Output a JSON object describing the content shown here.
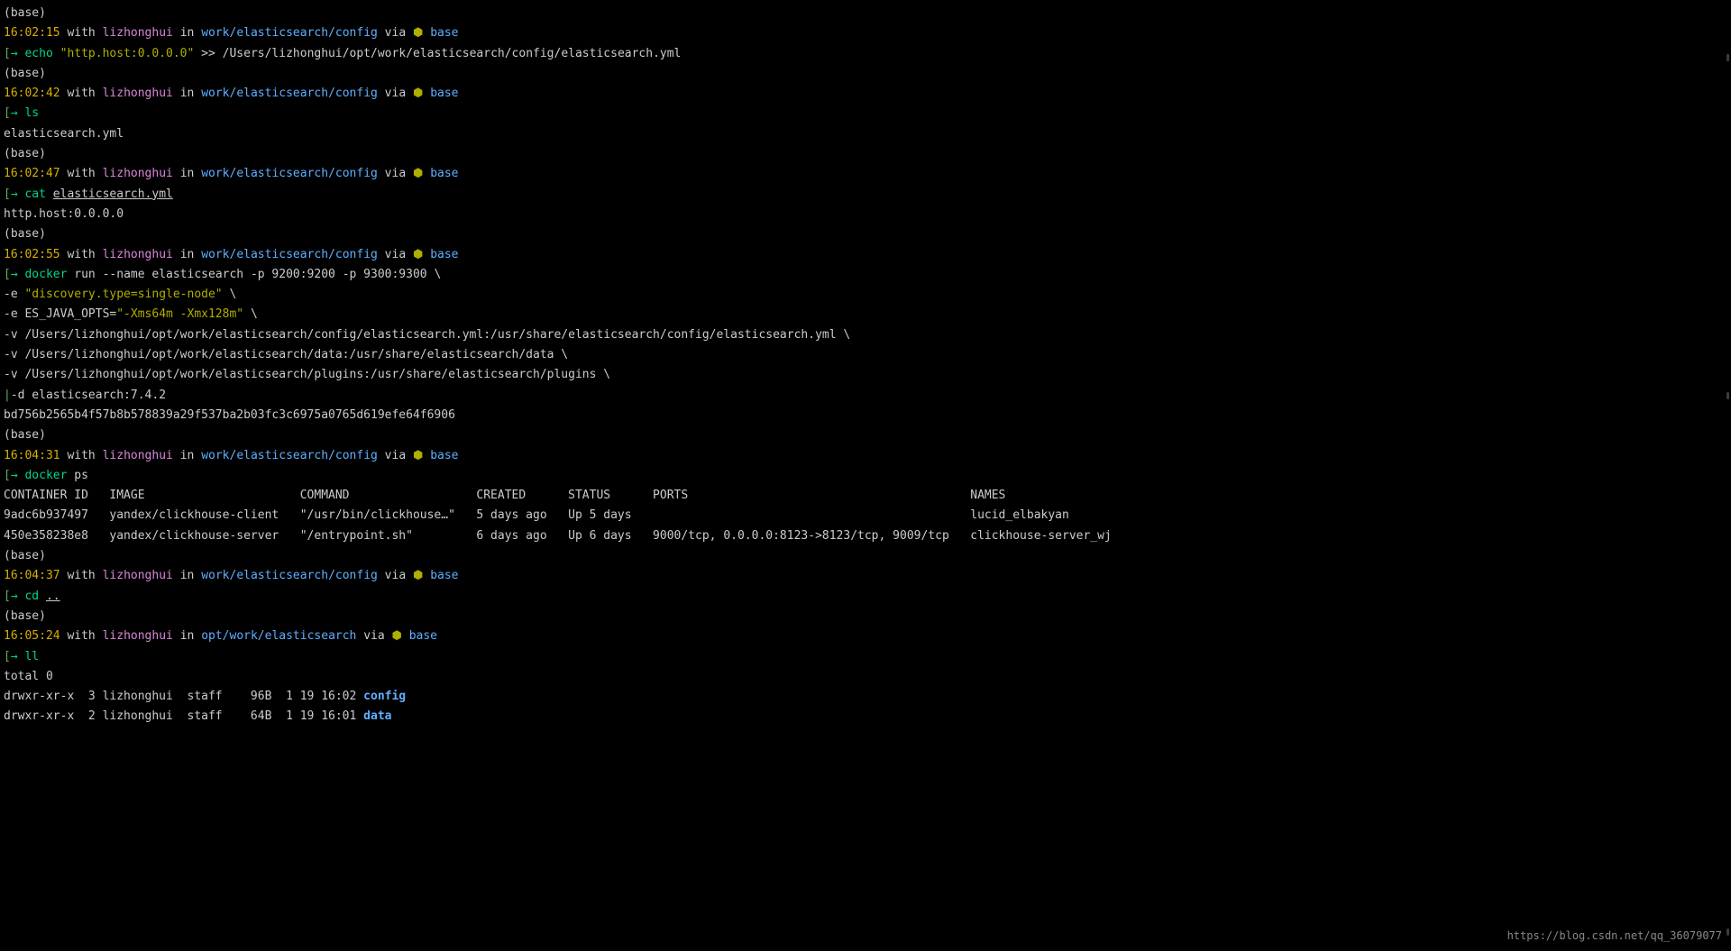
{
  "watermark": "https://blog.csdn.net/qq_36079077",
  "baseLabel": "(base)",
  "prompts": [
    {
      "time": "16:02:15",
      "user": "lizhonghui",
      "path": "work/elasticsearch/config",
      "env": "base"
    },
    {
      "time": "16:02:42",
      "user": "lizhonghui",
      "path": "work/elasticsearch/config",
      "env": "base"
    },
    {
      "time": "16:02:47",
      "user": "lizhonghui",
      "path": "work/elasticsearch/config",
      "env": "base"
    },
    {
      "time": "16:02:55",
      "user": "lizhonghui",
      "path": "work/elasticsearch/config",
      "env": "base"
    },
    {
      "time": "16:04:31",
      "user": "lizhonghui",
      "path": "work/elasticsearch/config",
      "env": "base"
    },
    {
      "time": "16:04:37",
      "user": "lizhonghui",
      "path": "work/elasticsearch/config",
      "env": "base"
    },
    {
      "time": "16:05:24",
      "user": "lizhonghui",
      "path": "opt/work/elasticsearch",
      "env": "base"
    }
  ],
  "cmds": {
    "echo": "echo",
    "echoArg": "\"http.host:0.0.0.0\"",
    "echoRedir": " >> /Users/lizhonghui/opt/work/elasticsearch/config/elasticsearch.yml",
    "ls": "ls",
    "lsOut": "elasticsearch.yml",
    "cat": "cat",
    "catFile": "elasticsearch.yml",
    "catOut": "http.host:0.0.0.0",
    "docker": "docker",
    "dockerRunArgs": " run --name elasticsearch -p 9200:9200 -p 9300:9300 \\",
    "dockerLine2a": "-e ",
    "dockerLine2b": "\"discovery.type=single-node\"",
    "dockerLine2c": " \\",
    "dockerLine3a": "-e ES_JAVA_OPTS=",
    "dockerLine3b": "\"-Xms64m -Xmx128m\"",
    "dockerLine3c": " \\",
    "dockerLine4": "-v /Users/lizhonghui/opt/work/elasticsearch/config/elasticsearch.yml:/usr/share/elasticsearch/config/elasticsearch.yml \\",
    "dockerLine5": "-v /Users/lizhonghui/opt/work/elasticsearch/data:/usr/share/elasticsearch/data \\",
    "dockerLine6": "-v /Users/lizhonghui/opt/work/elasticsearch/plugins:/usr/share/elasticsearch/plugins \\",
    "dockerLine7": "-d elasticsearch:7.4.2",
    "dockerHash": "bd756b2565b4f57b8b578839a29f537ba2b03fc3c6975a0765d619efe64f6906",
    "dockerPs": " ps",
    "cd": "cd",
    "cdArg": "..",
    "ll": "ll",
    "llTotal": "total 0",
    "llRow1a": "drwxr-xr-x  3 lizhonghui  staff    96B  1 19 16:02 ",
    "llRow1b": "config",
    "llRow2a": "drwxr-xr-x  2 lizhonghui  staff    64B  1 19 16:01 ",
    "llRow2b": "data"
  },
  "psHeader": "CONTAINER ID   IMAGE                      COMMAND                  CREATED      STATUS      PORTS                                        NAMES",
  "psRows": [
    "9adc6b937497   yandex/clickhouse-client   \"/usr/bin/clickhouse…\"   5 days ago   Up 5 days                                                lucid_elbakyan",
    "450e358238e8   yandex/clickhouse-server   \"/entrypoint.sh\"         6 days ago   Up 6 days   9000/tcp, 0.0.0.0:8123->8123/tcp, 9009/tcp   clickhouse-server_wj"
  ],
  "labels": {
    "with": " with ",
    "in": " in ",
    "via": " via ",
    "bracketOpen": "[",
    "arrow": "→ ",
    "envIcon": "⬢ ",
    "pipe": "|"
  }
}
